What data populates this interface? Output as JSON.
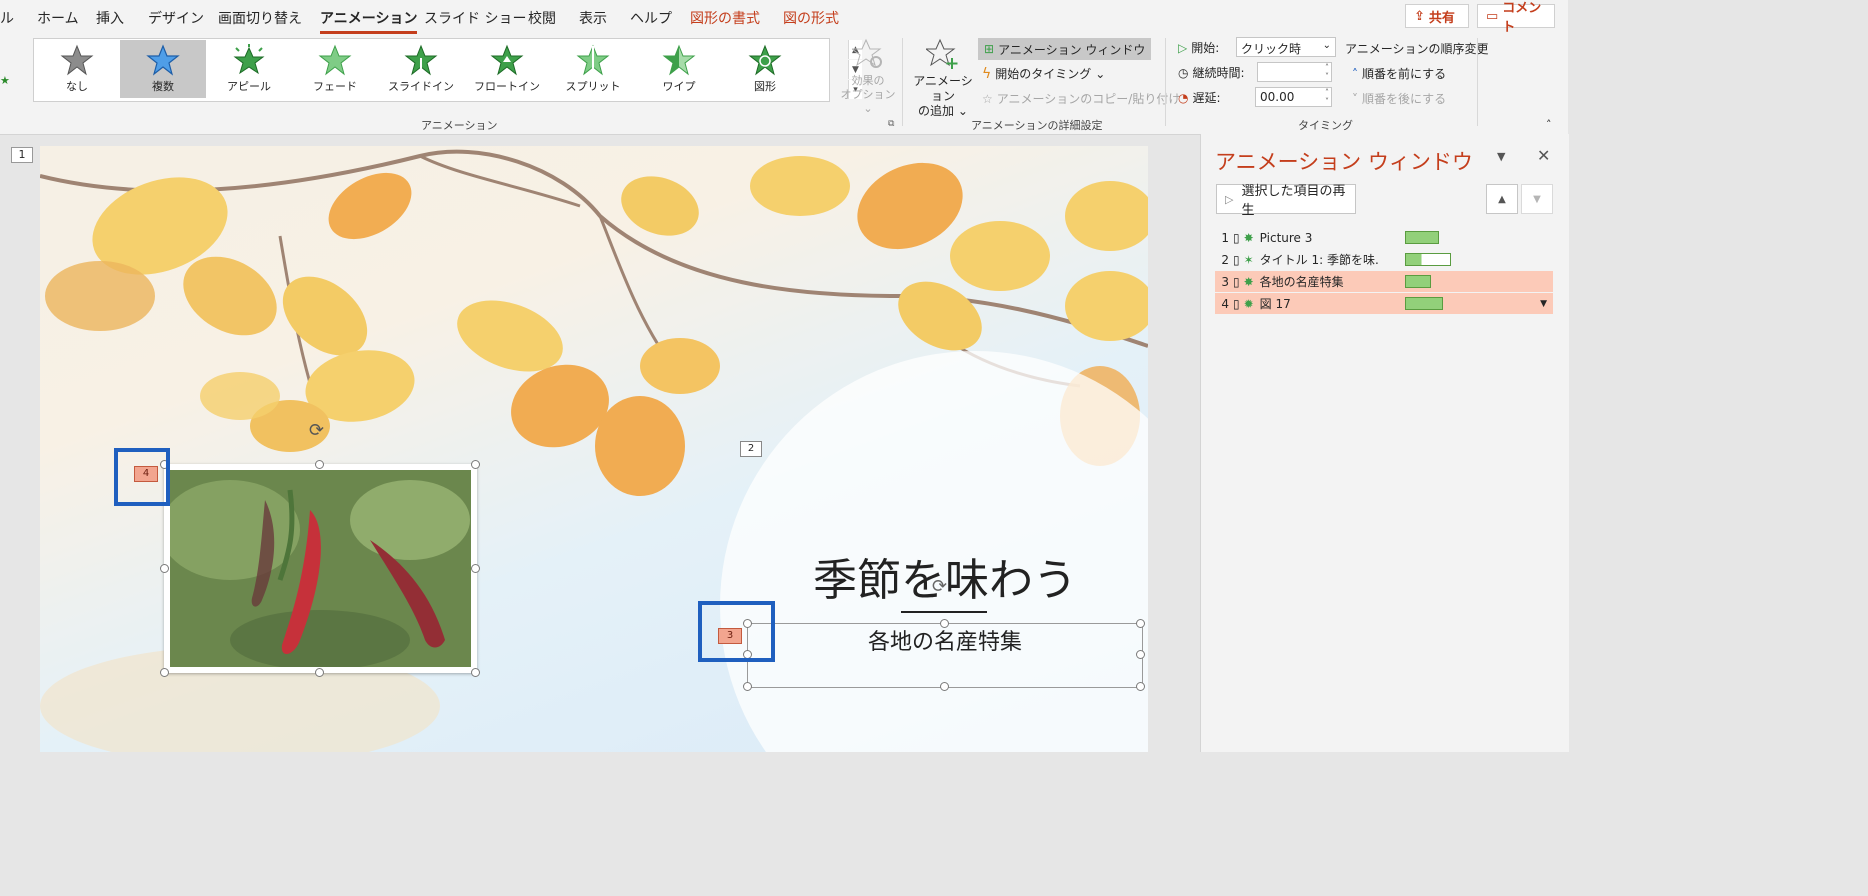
{
  "tabs": [
    "ル",
    "ホーム",
    "挿入",
    "デザイン",
    "画面切り替え",
    "アニメーション",
    "スライド ショー",
    "校閲",
    "表示",
    "ヘルプ",
    "図形の書式",
    "図の形式"
  ],
  "top_buttons": {
    "share": "共有",
    "comment": "コメント"
  },
  "gallery": {
    "items": [
      "なし",
      "複数",
      "アピール",
      "フェード",
      "スライドイン",
      "フロートイン",
      "スプリット",
      "ワイプ",
      "図形"
    ],
    "selected": "複数",
    "effect_options": [
      "効果の",
      "オプション"
    ]
  },
  "groups": {
    "animation": "アニメーション",
    "advanced": "アニメーションの詳細設定",
    "timing": "タイミング"
  },
  "advanced": {
    "add_animation": [
      "アニメーション",
      "の追加"
    ],
    "animation_pane": "アニメーション ウィンドウ",
    "trigger": "開始のタイミング",
    "painter": "アニメーションのコピー/貼り付け"
  },
  "timing": {
    "start_label": "開始:",
    "start_value": "クリック時",
    "duration_label": "継続時間:",
    "duration_value": "",
    "delay_label": "遅延:",
    "delay_value": "00.00",
    "reorder_title": "アニメーションの順序変更",
    "move_earlier": "順番を前にする",
    "move_later": "順番を後にする"
  },
  "slide": {
    "thumb_number": "1",
    "title": "季節を味わう",
    "subtitle": "各地の名産特集",
    "tags": {
      "picture": "4",
      "title": "2",
      "subtitle": "3"
    }
  },
  "pane": {
    "title": "アニメーション ウィンドウ",
    "play_button": "選択した項目の再生",
    "items": [
      {
        "num": "1",
        "label": "Picture 3",
        "bar_fraction": 0.22
      },
      {
        "num": "2",
        "label": "タイトル 1: 季節を味...",
        "bar_fraction": 0.32
      },
      {
        "num": "3",
        "label": "各地の名産特集",
        "bar_fraction": 0.18
      },
      {
        "num": "4",
        "label": "図 17",
        "bar_fraction": 0.25
      }
    ]
  },
  "colors": {
    "accent": "#c43e1c",
    "selection_blue": "#1f5fbf",
    "row_highlight": "#fccab8",
    "bar_green": "#92d07a"
  }
}
